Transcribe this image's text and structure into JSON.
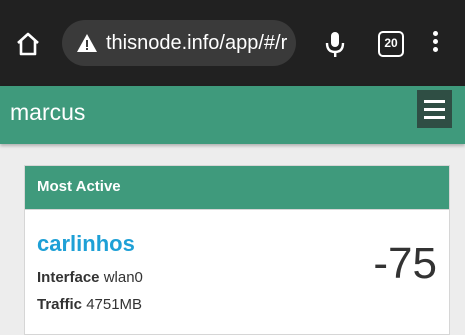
{
  "browser": {
    "url": "thisnode.info/app/#/r",
    "tab_count": "20",
    "icons": {
      "home": "home-icon",
      "warning": "warning-triangle-icon",
      "mic": "microphone-icon",
      "tabs": "tab-count-icon",
      "menu": "more-vert-icon"
    }
  },
  "app": {
    "title": "marcus",
    "menu_icon": "hamburger-menu-icon",
    "accent_color": "#3f9a7c"
  },
  "card": {
    "header": "Most Active",
    "node_name": "carlinhos",
    "signal_value": "-75",
    "interface_label": "Interface",
    "interface_value": "wlan0",
    "traffic_label": "Traffic",
    "traffic_value": "4751MB",
    "name_color": "#1ea0d6"
  }
}
